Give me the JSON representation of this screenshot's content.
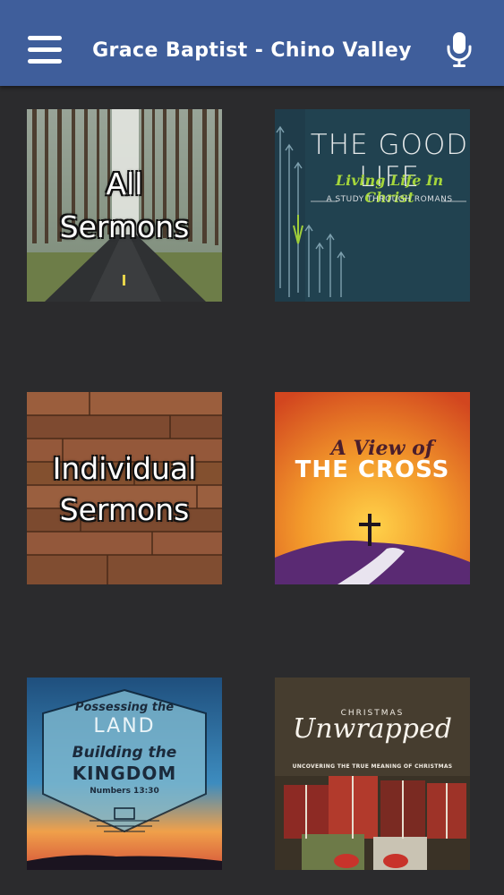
{
  "header": {
    "title": "Grace Baptist - Chino Valley",
    "menu_icon": "hamburger-menu-icon",
    "mic_icon": "microphone-icon",
    "background_color": "#3f5e9b"
  },
  "tiles": [
    {
      "id": "all-sermons",
      "lines": [
        "All",
        "Sermons"
      ]
    },
    {
      "id": "the-good-life",
      "title": "THE GOOD LIFE",
      "subtitle": "Living Life In Christ",
      "tagline": "A STUDY THROUGH ROMANS"
    },
    {
      "id": "individual-sermons",
      "lines": [
        "Individual",
        "Sermons"
      ]
    },
    {
      "id": "a-view-of-the-cross",
      "script": "A View of",
      "title": "THE CROSS"
    },
    {
      "id": "possessing-the-land",
      "line1": "Possessing the",
      "line2": "LAND",
      "line3": "Building the",
      "line4": "KINGDOM",
      "reference": "Numbers 13:30"
    },
    {
      "id": "christmas-unwrapped",
      "kicker": "CHRISTMAS",
      "title": "Unwrapped",
      "subtitle": "UNCOVERING THE TRUE MEANING OF CHRISTMAS"
    }
  ]
}
